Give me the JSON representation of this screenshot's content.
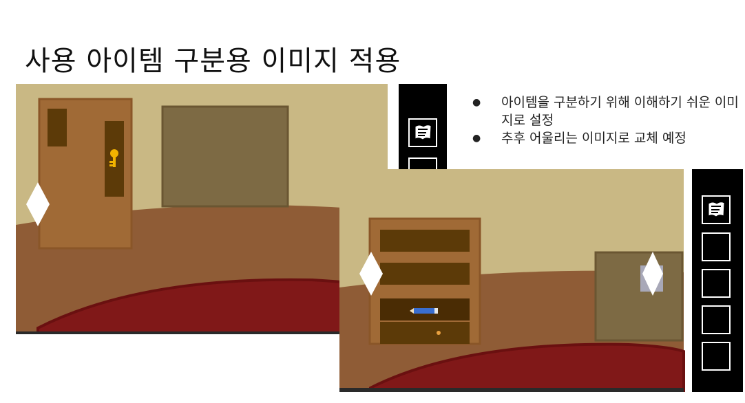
{
  "slide": {
    "title": "사용 아이템 구분용 이미지 적용",
    "bullets": [
      "아이템을 구분하기 위해 이해하기 쉬운 이미지로 설정",
      "추후 어울리는 이미지로 교체 예정"
    ]
  },
  "screenshot_1": {
    "room": "door-room",
    "inventory": {
      "slots": [
        "map-icon",
        "empty"
      ]
    },
    "items_visible": [
      "key-icon"
    ],
    "nav_arrows": [
      "left"
    ]
  },
  "screenshot_2": {
    "room": "drawer-room",
    "inventory": {
      "slots": [
        "map-icon",
        "empty",
        "empty",
        "empty",
        "empty"
      ]
    },
    "items_visible": [
      "pencil-icon"
    ],
    "nav_arrows": [
      "left",
      "right"
    ]
  },
  "colors": {
    "wall": "#c9b884",
    "floor": "#8f5c36",
    "rug": "#801818",
    "door": "#a06a36",
    "panel": "#5c3a08",
    "frame": "#7d6a44",
    "inventory_bg": "#000000",
    "key": "#f2b300",
    "pencil": "#3a6ecf"
  }
}
